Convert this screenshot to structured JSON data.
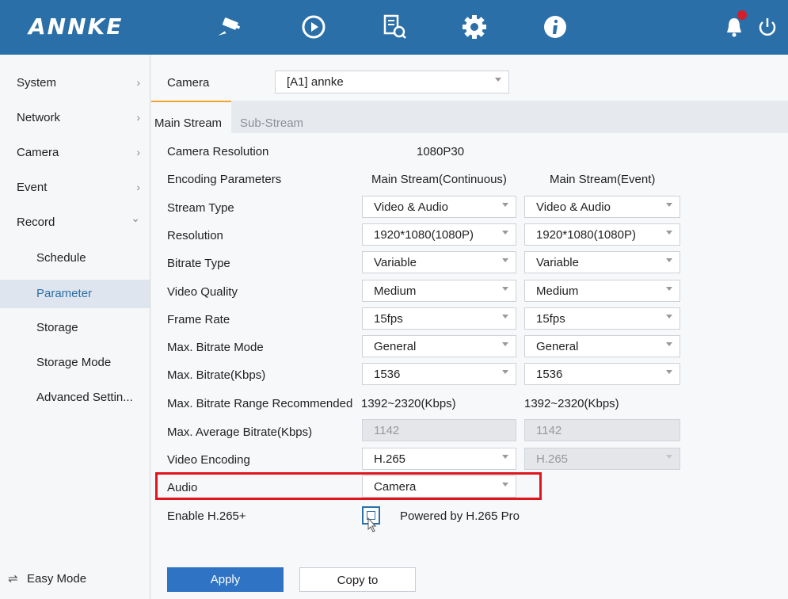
{
  "header": {
    "logo": "ANNKE",
    "icons": [
      "camera-icon",
      "playback-icon",
      "search-icon",
      "settings-icon",
      "info-icon",
      "bell-icon",
      "power-icon"
    ],
    "accent_color": "#2a6fa8",
    "alert_color": "#d21f2a"
  },
  "sidebar": {
    "items": [
      {
        "label": "System",
        "expand": "›"
      },
      {
        "label": "Network",
        "expand": "›"
      },
      {
        "label": "Camera",
        "expand": "›"
      },
      {
        "label": "Event",
        "expand": "›"
      },
      {
        "label": "Record",
        "expand": "⌄"
      }
    ],
    "subitems": [
      "Schedule",
      "Parameter",
      "Storage",
      "Storage Mode",
      "Advanced Settin..."
    ],
    "active": "Parameter",
    "easy_mode": "Easy Mode"
  },
  "camera": {
    "label": "Camera",
    "value": "[A1] annke"
  },
  "tabs": [
    {
      "label": "Main Stream",
      "active": true
    },
    {
      "label": "Sub-Stream",
      "active": false
    }
  ],
  "form": {
    "resolution_label": "Camera Resolution",
    "resolution_value": "1080P30",
    "encoding_label": "Encoding Parameters",
    "col_continuous": "Main Stream(Continuous)",
    "col_event": "Main Stream(Event)",
    "stream_type": {
      "label": "Stream Type",
      "continuous": "Video & Audio",
      "event": "Video & Audio"
    },
    "resolution": {
      "label": "Resolution",
      "continuous": "1920*1080(1080P)",
      "event": "1920*1080(1080P)"
    },
    "bitrate_type": {
      "label": "Bitrate Type",
      "continuous": "Variable",
      "event": "Variable"
    },
    "video_quality": {
      "label": "Video Quality",
      "continuous": "Medium",
      "event": "Medium"
    },
    "frame_rate": {
      "label": "Frame Rate",
      "continuous": "15fps",
      "event": "15fps"
    },
    "max_bitrate_mode": {
      "label": "Max. Bitrate Mode",
      "continuous": "General",
      "event": "General"
    },
    "max_bitrate": {
      "label": "Max. Bitrate(Kbps)",
      "continuous": "1536",
      "event": "1536"
    },
    "bitrate_range": {
      "label": "Max. Bitrate Range Recommended",
      "continuous": "1392~2320(Kbps)",
      "event": "1392~2320(Kbps)"
    },
    "avg_bitrate": {
      "label": "Max. Average Bitrate(Kbps)",
      "continuous": "1142",
      "event": "1142"
    },
    "video_encoding": {
      "label": "Video Encoding",
      "continuous": "H.265",
      "event": "H.265"
    },
    "audio": {
      "label": "Audio",
      "value": "Camera"
    },
    "h265plus": {
      "label": "Enable H.265+",
      "note": "Powered by H.265 Pro",
      "checked": false
    }
  },
  "buttons": {
    "apply": "Apply",
    "copy": "Copy to"
  }
}
